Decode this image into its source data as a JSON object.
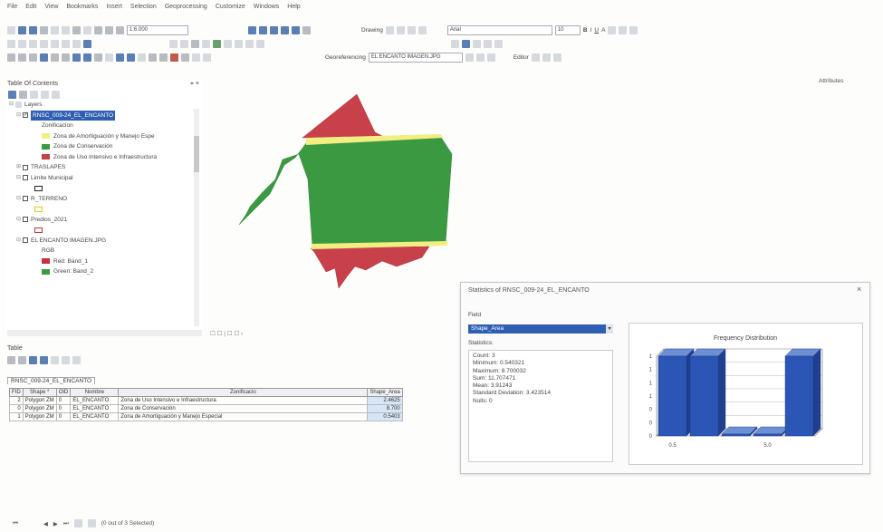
{
  "menu": [
    "File",
    "Edit",
    "View",
    "Bookmarks",
    "Insert",
    "Selection",
    "Geoprocessing",
    "Customize",
    "Windows",
    "Help"
  ],
  "toolbar": {
    "scale": "1:6.000",
    "drawing_label": "Drawing",
    "font_name": "Arial",
    "font_size": "10",
    "georeferencing_label": "Georeferencing",
    "georef_layer": "EL ENCANTO IMAGEN.JPG",
    "editor_label": "Editor"
  },
  "toc": {
    "title": "Table Of Contents",
    "close": "⌖ ×",
    "items": [
      {
        "kind": "group",
        "label": "Layers"
      },
      {
        "kind": "layer",
        "label": "RNSC_009-24_EL_ENCANTO",
        "checked": true,
        "selected": true
      },
      {
        "kind": "text",
        "label": "Zonificacion"
      },
      {
        "kind": "legend",
        "label": "Zona de Amortiguación y Manejo Espe",
        "color": "#f2ee82"
      },
      {
        "kind": "legend",
        "label": "Zona de Conservación",
        "color": "#3c9a40"
      },
      {
        "kind": "legend",
        "label": "Zona de Uso Intensivo e Infraestructura",
        "color": "#c04244"
      },
      {
        "kind": "layer",
        "label": "TRASLAPES",
        "checked": false
      },
      {
        "kind": "layer",
        "label": "Limite Municipal",
        "checked": false
      },
      {
        "kind": "outline",
        "color": "#222222"
      },
      {
        "kind": "layer",
        "label": "R_TERRENO",
        "checked": false
      },
      {
        "kind": "outline",
        "color": "#e0cd1c"
      },
      {
        "kind": "layer",
        "label": "Predios_2021",
        "checked": false
      },
      {
        "kind": "outline",
        "color": "#b8373f"
      },
      {
        "kind": "layer",
        "label": "EL ENCANTO IMAGEN.JPG",
        "checked": false
      },
      {
        "kind": "text",
        "label": "RGB"
      },
      {
        "kind": "legend",
        "label": "Red: Band_1",
        "color": "#c9303a"
      },
      {
        "kind": "legend",
        "label": "Green: Band_2",
        "color": "#3c9a40"
      }
    ]
  },
  "map_nav": "☐ ☐ | ☐ ☐ ‹",
  "attributes_panel": {
    "title": "Attributes"
  },
  "table": {
    "title": "Table",
    "tab_name": "RNSC_009-24_EL_ENCANTO",
    "columns": [
      "FID",
      "Shape *",
      "OID",
      "Nombre",
      "Zonificacio",
      "Shape_Area"
    ],
    "rows": [
      [
        "2",
        "Polygon ZM",
        "0",
        "EL_ENCANTO",
        "Zona de Uso Intensivo e Infraestructura",
        "2.4625"
      ],
      [
        "0",
        "Polygon ZM",
        "0",
        "EL_ENCANTO",
        "Zona de Conservación",
        "8.700"
      ],
      [
        "1",
        "Polygon ZM",
        "0",
        "EL_ENCANTO",
        "Zona de Amortiguación y Manejo Especial",
        "0.5403"
      ]
    ],
    "footer": "(0 out of 3 Selected)"
  },
  "stats_dialog": {
    "title": "Statistics of RNSC_009-24_EL_ENCANTO",
    "field_label": "Field",
    "field_value": "Shape_Area",
    "statistics_label": "Statistics:",
    "stats": [
      "Count:   3",
      "Minimum: 0.540321",
      "Maximum: 8.700032",
      "Sum:     11.707471",
      "Mean:    3.91243",
      "Standard Deviation: 3.423514",
      "Nulls:   0"
    ],
    "close": "×"
  },
  "chart_data": {
    "type": "bar",
    "title": "Frequency Distribution",
    "values": [
      2,
      2,
      0,
      0,
      2
    ],
    "x_tick_labels": [
      "0.5",
      "5.0"
    ],
    "y_tick_labels": [
      "1",
      "1",
      "1",
      "1",
      "0",
      "0",
      "0"
    ],
    "bar_color": "#2c56b5"
  }
}
